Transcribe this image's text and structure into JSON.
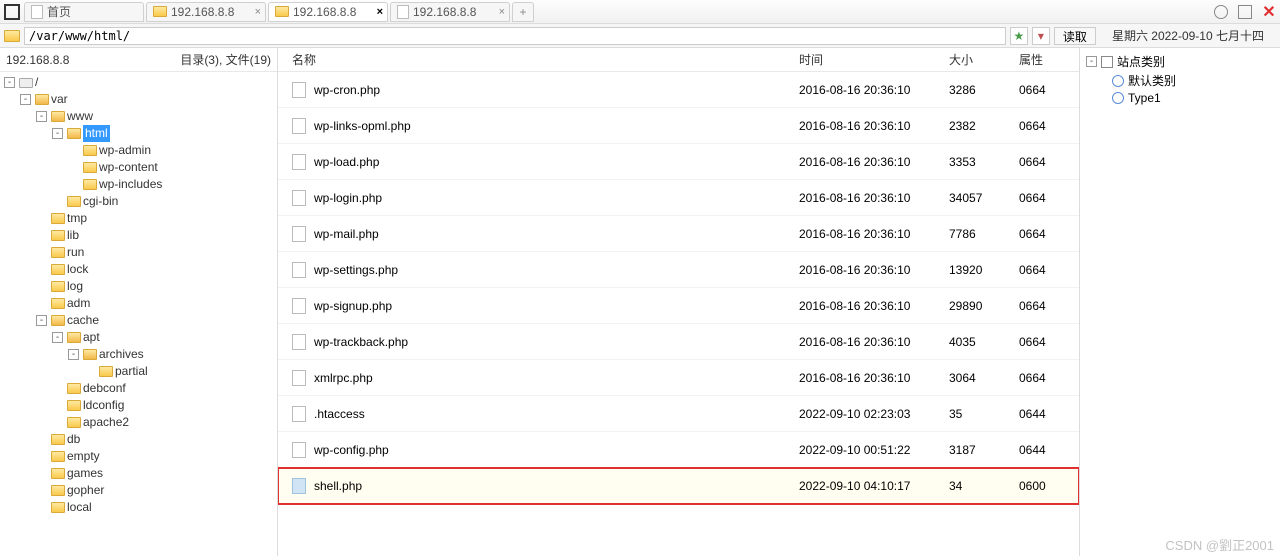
{
  "titlebar": {
    "tabs": [
      {
        "label": "首页",
        "icon": "home",
        "closable": false
      },
      {
        "label": "192.168.8.8",
        "icon": "folder",
        "closable": true
      },
      {
        "label": "192.168.8.8",
        "icon": "folder",
        "closable": true,
        "active": true
      },
      {
        "label": "192.168.8.8",
        "icon": "file",
        "closable": true
      }
    ],
    "new_tab": "+"
  },
  "address": {
    "path": "/var/www/html/",
    "read_btn": "读取",
    "date_label": "星期六 2022-09-10 七月十四"
  },
  "tree": {
    "host": "192.168.8.8",
    "dir_info": "目录(3), 文件(19)",
    "root": "/",
    "nodes": [
      {
        "depth": 0,
        "exp": "-",
        "icon": "disk",
        "label": "/"
      },
      {
        "depth": 1,
        "exp": "-",
        "icon": "open",
        "label": "var"
      },
      {
        "depth": 2,
        "exp": "-",
        "icon": "open",
        "label": "www"
      },
      {
        "depth": 3,
        "exp": "-",
        "icon": "open",
        "label": "html",
        "selected": true
      },
      {
        "depth": 4,
        "exp": " ",
        "icon": "folder",
        "label": "wp-admin"
      },
      {
        "depth": 4,
        "exp": " ",
        "icon": "folder",
        "label": "wp-content"
      },
      {
        "depth": 4,
        "exp": " ",
        "icon": "folder",
        "label": "wp-includes"
      },
      {
        "depth": 3,
        "exp": " ",
        "icon": "folder",
        "label": "cgi-bin"
      },
      {
        "depth": 2,
        "exp": " ",
        "icon": "folder",
        "label": "tmp"
      },
      {
        "depth": 2,
        "exp": " ",
        "icon": "folder",
        "label": "lib"
      },
      {
        "depth": 2,
        "exp": " ",
        "icon": "folder",
        "label": "run"
      },
      {
        "depth": 2,
        "exp": " ",
        "icon": "folder",
        "label": "lock"
      },
      {
        "depth": 2,
        "exp": " ",
        "icon": "folder",
        "label": "log"
      },
      {
        "depth": 2,
        "exp": " ",
        "icon": "folder",
        "label": "adm"
      },
      {
        "depth": 2,
        "exp": "-",
        "icon": "open",
        "label": "cache"
      },
      {
        "depth": 3,
        "exp": "-",
        "icon": "open",
        "label": "apt"
      },
      {
        "depth": 4,
        "exp": "-",
        "icon": "open",
        "label": "archives"
      },
      {
        "depth": 5,
        "exp": " ",
        "icon": "folder",
        "label": "partial"
      },
      {
        "depth": 3,
        "exp": " ",
        "icon": "folder",
        "label": "debconf"
      },
      {
        "depth": 3,
        "exp": " ",
        "icon": "folder",
        "label": "ldconfig"
      },
      {
        "depth": 3,
        "exp": " ",
        "icon": "folder",
        "label": "apache2"
      },
      {
        "depth": 2,
        "exp": " ",
        "icon": "folder",
        "label": "db"
      },
      {
        "depth": 2,
        "exp": " ",
        "icon": "folder",
        "label": "empty"
      },
      {
        "depth": 2,
        "exp": " ",
        "icon": "folder",
        "label": "games"
      },
      {
        "depth": 2,
        "exp": " ",
        "icon": "folder",
        "label": "gopher"
      },
      {
        "depth": 2,
        "exp": " ",
        "icon": "folder",
        "label": "local"
      }
    ]
  },
  "files": {
    "headers": {
      "name": "名称",
      "time": "时间",
      "size": "大小",
      "attr": "属性"
    },
    "rows": [
      {
        "name": "wp-cron.php",
        "time": "2016-08-16 20:36:10",
        "size": "3286",
        "attr": "0664"
      },
      {
        "name": "wp-links-opml.php",
        "time": "2016-08-16 20:36:10",
        "size": "2382",
        "attr": "0664"
      },
      {
        "name": "wp-load.php",
        "time": "2016-08-16 20:36:10",
        "size": "3353",
        "attr": "0664"
      },
      {
        "name": "wp-login.php",
        "time": "2016-08-16 20:36:10",
        "size": "34057",
        "attr": "0664"
      },
      {
        "name": "wp-mail.php",
        "time": "2016-08-16 20:36:10",
        "size": "7786",
        "attr": "0664"
      },
      {
        "name": "wp-settings.php",
        "time": "2016-08-16 20:36:10",
        "size": "13920",
        "attr": "0664"
      },
      {
        "name": "wp-signup.php",
        "time": "2016-08-16 20:36:10",
        "size": "29890",
        "attr": "0664"
      },
      {
        "name": "wp-trackback.php",
        "time": "2016-08-16 20:36:10",
        "size": "4035",
        "attr": "0664"
      },
      {
        "name": "xmlrpc.php",
        "time": "2016-08-16 20:36:10",
        "size": "3064",
        "attr": "0664"
      },
      {
        "name": ".htaccess",
        "time": "2022-09-10 02:23:03",
        "size": "35",
        "attr": "0644"
      },
      {
        "name": "wp-config.php",
        "time": "2022-09-10 00:51:22",
        "size": "3187",
        "attr": "0644"
      },
      {
        "name": "shell.php",
        "time": "2022-09-10 04:10:17",
        "size": "34",
        "attr": "0600",
        "highlight": true,
        "blue": true
      }
    ]
  },
  "sidebar": {
    "title": "站点类别",
    "items": [
      {
        "label": "默认类别"
      },
      {
        "label": "Type1"
      }
    ]
  },
  "watermark": "CSDN @劉正2001"
}
